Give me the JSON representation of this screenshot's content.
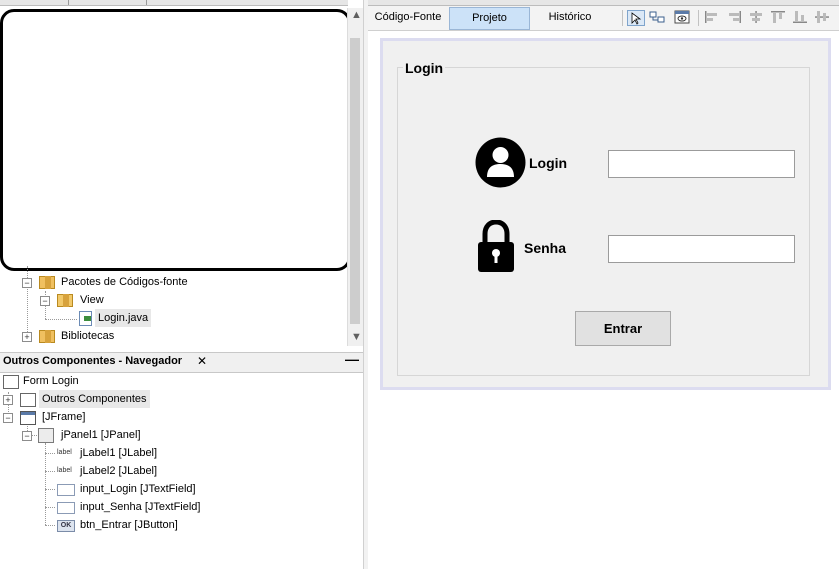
{
  "left_panel": {
    "project_tree": [
      {
        "label": "Pacotes de Códigos-fonte"
      },
      {
        "label": "View"
      },
      {
        "label": "Login.java"
      },
      {
        "label": "Bibliotecas"
      }
    ]
  },
  "navigator": {
    "title": "Outros Componentes - Navegador",
    "close_glyph": "✕",
    "minimize_glyph": "—",
    "items": [
      {
        "label": "Form Login",
        "icon": "form-icon"
      },
      {
        "label": "Outros Componentes",
        "icon": "components-icon"
      },
      {
        "label": "[JFrame]",
        "icon": "frame-icon"
      },
      {
        "label": "jPanel1 [JPanel]",
        "icon": "panel-icon"
      },
      {
        "label": "jLabel1 [JLabel]",
        "icon": "label-icon",
        "icon_text": "label"
      },
      {
        "label": "jLabel2 [JLabel]",
        "icon": "label-icon",
        "icon_text": "label"
      },
      {
        "label": "input_Login [JTextField]",
        "icon": "textfield-icon"
      },
      {
        "label": "input_Senha [JTextField]",
        "icon": "textfield-icon"
      },
      {
        "label": "btn_Entrar [JButton]",
        "icon": "button-icon",
        "icon_text": "OK"
      }
    ]
  },
  "editor": {
    "tabs": [
      {
        "label": "Código-Fonte",
        "active": false
      },
      {
        "label": "Projeto",
        "active": true
      },
      {
        "label": "Histórico",
        "active": false
      }
    ],
    "form": {
      "border_title": "Login",
      "login_label": "Login",
      "senha_label": "Senha",
      "login_value": "",
      "senha_value": "",
      "button_label": "Entrar"
    }
  },
  "colors": {
    "active_tab": "#cce2f8",
    "form_background": "#f0f0f0",
    "design_border": "#dcdcf0"
  }
}
